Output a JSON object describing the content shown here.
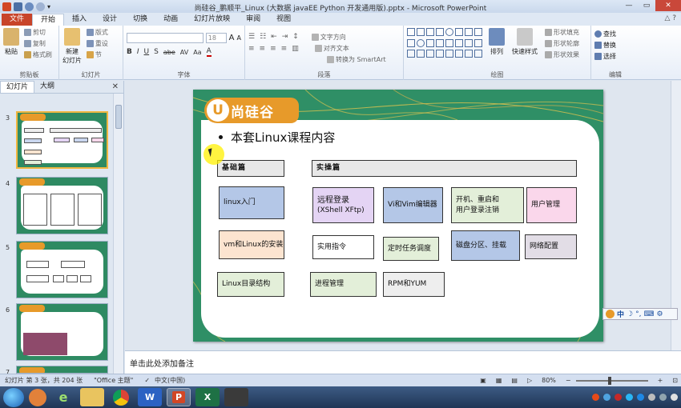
{
  "window": {
    "title": "尚硅谷_鹏顺平_Linux (大数据 javaEE Python 开发通用版).pptx - Microsoft PowerPoint",
    "minimize": "—",
    "maximize": "▭",
    "close": "✕"
  },
  "tabs": [
    "文件",
    "开始",
    "插入",
    "设计",
    "切换",
    "动画",
    "幻灯片放映",
    "审阅",
    "视图"
  ],
  "active_tab": "开始",
  "ribbon": {
    "clipboard": {
      "label": "剪贴板",
      "paste": "粘贴",
      "cut": "剪切",
      "copy": "复制",
      "format_painter": "格式刷"
    },
    "slides": {
      "label": "幻灯片",
      "new_slide": "新建",
      "new_slide2": "幻灯片",
      "layout": "版式",
      "reset": "重设",
      "section": "节"
    },
    "font": {
      "label": "字体",
      "font_name": "",
      "font_size": "18",
      "bold": "B",
      "italic": "I",
      "underline": "U",
      "shadow": "S",
      "strike": "abe",
      "spacing": "AV",
      "case": "Aa",
      "color": "A",
      "grow": "A",
      "shrink": "A"
    },
    "paragraph": {
      "label": "段落",
      "text_direction": "文字方向",
      "align_text": "对齐文本",
      "smartart": "转换为 SmartArt"
    },
    "drawing": {
      "label": "绘图",
      "arrange": "排列",
      "quick_styles": "快速样式",
      "fill": "形状填充",
      "outline": "形状轮廓",
      "effects": "形状效果"
    },
    "editing": {
      "label": "编辑",
      "find": "查找",
      "replace": "替换",
      "select": "选择"
    }
  },
  "panel": {
    "tab_slides": "幻灯片",
    "tab_outline": "大纲",
    "close": "✕",
    "thumbs": [
      {
        "num": "3",
        "selected": true
      },
      {
        "num": "4",
        "selected": false
      },
      {
        "num": "5",
        "selected": false
      },
      {
        "num": "6",
        "selected": false
      },
      {
        "num": "7",
        "selected": false
      }
    ]
  },
  "slide": {
    "logo_text": "尚硅谷",
    "heading": "本套Linux课程内容",
    "basic_header": "基础篇",
    "practical_header": "实操篇",
    "boxes": {
      "linux_intro": "linux入门",
      "vm_install": "vm和Linux的安装",
      "dir_structure": "Linux目录结构",
      "remote_login_1": "远程登录",
      "remote_login_2": "(XShell XFtp)",
      "vi_vim": "Vi和Vim编辑器",
      "boot_1": "开机、重启和",
      "boot_2": "用户登录注销",
      "user_mgmt": "用户管理",
      "practical_cmds": "实用指令",
      "cron": "定时任务调度",
      "disk": "磁盘分区、挂载",
      "network": "网络配置",
      "process": "进程管理",
      "rpm_yum": "RPM和YUM"
    },
    "colors": {
      "green_bg": "#2f8f66",
      "orange_logo": "#e79a2a",
      "blue_box": "#b4c7e7",
      "lavender_box": "#e4d4f4",
      "orange_box": "#fce4d0",
      "green_box": "#e3efd9",
      "pink_box": "#fad7eb",
      "gray_box": "#e2dde6"
    }
  },
  "ime": {
    "label": "中",
    "moon": "☽",
    "dot": "°,"
  },
  "notes": {
    "placeholder": "单击此处添加备注"
  },
  "status": {
    "slide_info": "幻灯片 第 3 张，共 204 张",
    "theme": "\"Office 主题\"",
    "language": "中文(中国)",
    "zoom": "80%",
    "zoom_minus": "−",
    "zoom_plus": "+"
  }
}
